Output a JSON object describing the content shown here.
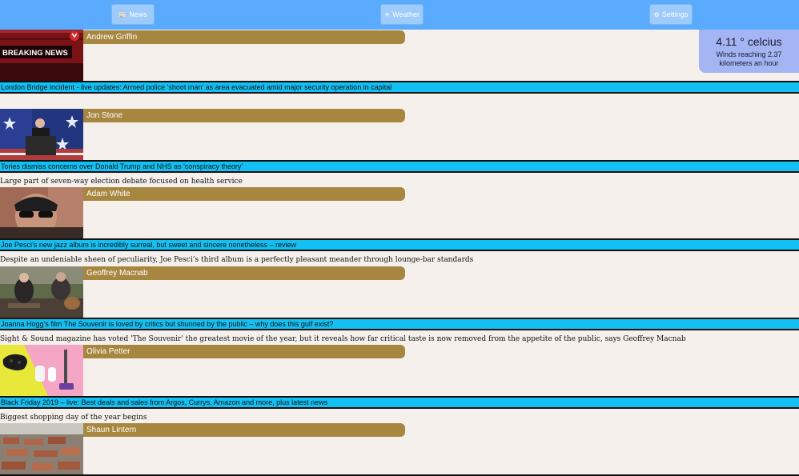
{
  "nav": {
    "news_label": "News",
    "weather_label": "Weather",
    "settings_label": "Settings"
  },
  "weather": {
    "temperature": "4.11 ° celcius",
    "wind": "Winds reaching 2.37 kilometers an hour"
  },
  "articles": [
    {
      "author": "Andrew Griffin",
      "thumb_text": "BREAKING NEWS",
      "headline": "London Bridge incident - live updates: Armed police 'shoot man' as area evacuated amid major security operation in capital",
      "subtitle": ""
    },
    {
      "author": "Jon Stone",
      "headline": "Tories dismiss concerns over Donald Trump and NHS as 'conspiracy theory'",
      "subtitle": "Large part of seven-way election debate focused on health service"
    },
    {
      "author": "Adam White",
      "headline": "Joe Pesci’s new jazz album is incredibly surreal, but sweet and sincere nonetheless – review",
      "subtitle": "Despite an undeniable sheen of peculiarity, Joe Pesci’s third album is a perfectly pleasant meander through lounge-bar standards"
    },
    {
      "author": "Geoffrey Macnab",
      "headline": "Joanna Hogg’s film The Souvenir is loved by critics but shunned by the public – why does this gulf exist?",
      "subtitle": "Sight & Sound magazine has voted 'The Souvenir' the greatest movie of the year, but it reveals how far critical taste is now removed from the appetite of the public, says Geoffrey Macnab"
    },
    {
      "author": "Olivia Petter",
      "headline": "Black Friday 2019 – live: Best deals and sales from Argos, Currys, Amazon and more, plus latest news",
      "subtitle": "Biggest shopping day of the year begins"
    },
    {
      "author": "Shaun Lintern",
      "headline": "",
      "subtitle": ""
    }
  ],
  "colors": {
    "topbar": "#5aabfe",
    "headline_bar": "#12c0f3",
    "author_bar": "#a7863f",
    "weather_card": "#a4b5f3",
    "page_bg": "#f5f0eb"
  }
}
